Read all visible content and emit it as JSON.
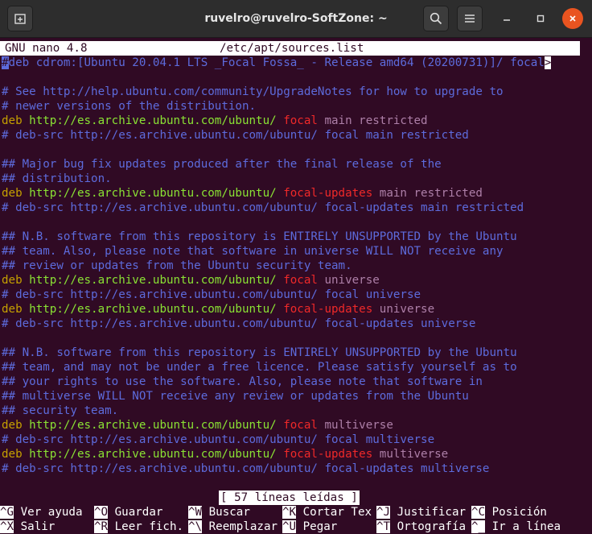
{
  "window": {
    "title": "ruvelro@ruvelro-SoftZone: ~",
    "buttons": [
      "new-tab",
      "search",
      "menu",
      "minimize",
      "maximize",
      "close"
    ]
  },
  "nano": {
    "app": "GNU nano 4.8",
    "file": "/etc/apt/sources.list",
    "status": "[ 57 líneas leídas ]",
    "truncation_marker": ">"
  },
  "colors": {
    "background": "#300a24",
    "comment": "#5d6bdc",
    "deb": "#c5a000",
    "url": "#8ae234",
    "release": "#ef2929",
    "component": "#ad7fa8"
  },
  "lines": [
    [
      [
        "comment",
        "#deb cdrom:[Ubuntu 20.04.1 LTS _Focal Fossa_ - Release amd64 (20200731)]/ focal"
      ]
    ],
    [
      [
        "comment",
        ""
      ]
    ],
    [
      [
        "comment",
        "# See http://help.ubuntu.com/community/UpgradeNotes for how to upgrade to"
      ]
    ],
    [
      [
        "comment",
        "# newer versions of the distribution."
      ]
    ],
    [
      [
        "deb",
        "deb "
      ],
      [
        "url",
        "http://es.archive.ubuntu.com/ubuntu/"
      ],
      [
        "rel",
        " focal"
      ],
      [
        "comp",
        " main restricted"
      ]
    ],
    [
      [
        "comment",
        "# deb-src http://es.archive.ubuntu.com/ubuntu/ focal main restricted"
      ]
    ],
    [
      [
        "comment",
        ""
      ]
    ],
    [
      [
        "comment",
        "## Major bug fix updates produced after the final release of the"
      ]
    ],
    [
      [
        "comment",
        "## distribution."
      ]
    ],
    [
      [
        "deb",
        "deb "
      ],
      [
        "url",
        "http://es.archive.ubuntu.com/ubuntu/"
      ],
      [
        "rel",
        " focal-updates"
      ],
      [
        "comp",
        " main restricted"
      ]
    ],
    [
      [
        "comment",
        "# deb-src http://es.archive.ubuntu.com/ubuntu/ focal-updates main restricted"
      ]
    ],
    [
      [
        "comment",
        ""
      ]
    ],
    [
      [
        "comment",
        "## N.B. software from this repository is ENTIRELY UNSUPPORTED by the Ubuntu"
      ]
    ],
    [
      [
        "comment",
        "## team. Also, please note that software in universe WILL NOT receive any"
      ]
    ],
    [
      [
        "comment",
        "## review or updates from the Ubuntu security team."
      ]
    ],
    [
      [
        "deb",
        "deb "
      ],
      [
        "url",
        "http://es.archive.ubuntu.com/ubuntu/"
      ],
      [
        "rel",
        " focal"
      ],
      [
        "comp",
        " universe"
      ]
    ],
    [
      [
        "comment",
        "# deb-src http://es.archive.ubuntu.com/ubuntu/ focal universe"
      ]
    ],
    [
      [
        "deb",
        "deb "
      ],
      [
        "url",
        "http://es.archive.ubuntu.com/ubuntu/"
      ],
      [
        "rel",
        " focal-updates"
      ],
      [
        "comp",
        " universe"
      ]
    ],
    [
      [
        "comment",
        "# deb-src http://es.archive.ubuntu.com/ubuntu/ focal-updates universe"
      ]
    ],
    [
      [
        "comment",
        ""
      ]
    ],
    [
      [
        "comment",
        "## N.B. software from this repository is ENTIRELY UNSUPPORTED by the Ubuntu"
      ]
    ],
    [
      [
        "comment",
        "## team, and may not be under a free licence. Please satisfy yourself as to"
      ]
    ],
    [
      [
        "comment",
        "## your rights to use the software. Also, please note that software in"
      ]
    ],
    [
      [
        "comment",
        "## multiverse WILL NOT receive any review or updates from the Ubuntu"
      ]
    ],
    [
      [
        "comment",
        "## security team."
      ]
    ],
    [
      [
        "deb",
        "deb "
      ],
      [
        "url",
        "http://es.archive.ubuntu.com/ubuntu/"
      ],
      [
        "rel",
        " focal"
      ],
      [
        "comp",
        " multiverse"
      ]
    ],
    [
      [
        "comment",
        "# deb-src http://es.archive.ubuntu.com/ubuntu/ focal multiverse"
      ]
    ],
    [
      [
        "deb",
        "deb "
      ],
      [
        "url",
        "http://es.archive.ubuntu.com/ubuntu/"
      ],
      [
        "rel",
        " focal-updates"
      ],
      [
        "comp",
        " multiverse"
      ]
    ],
    [
      [
        "comment",
        "# deb-src http://es.archive.ubuntu.com/ubuntu/ focal-updates multiverse"
      ]
    ]
  ],
  "shortcuts": {
    "row1": [
      {
        "key": "^G",
        "label": "Ver ayuda"
      },
      {
        "key": "^O",
        "label": "Guardar"
      },
      {
        "key": "^W",
        "label": "Buscar"
      },
      {
        "key": "^K",
        "label": "Cortar Tex"
      },
      {
        "key": "^J",
        "label": "Justificar"
      },
      {
        "key": "^C",
        "label": "Posición"
      }
    ],
    "row2": [
      {
        "key": "^X",
        "label": "Salir"
      },
      {
        "key": "^R",
        "label": "Leer fich."
      },
      {
        "key": "^\\",
        "label": "Reemplazar"
      },
      {
        "key": "^U",
        "label": "Pegar"
      },
      {
        "key": "^T",
        "label": "Ortografía"
      },
      {
        "key": "^_",
        "label": "Ir a línea"
      }
    ]
  }
}
